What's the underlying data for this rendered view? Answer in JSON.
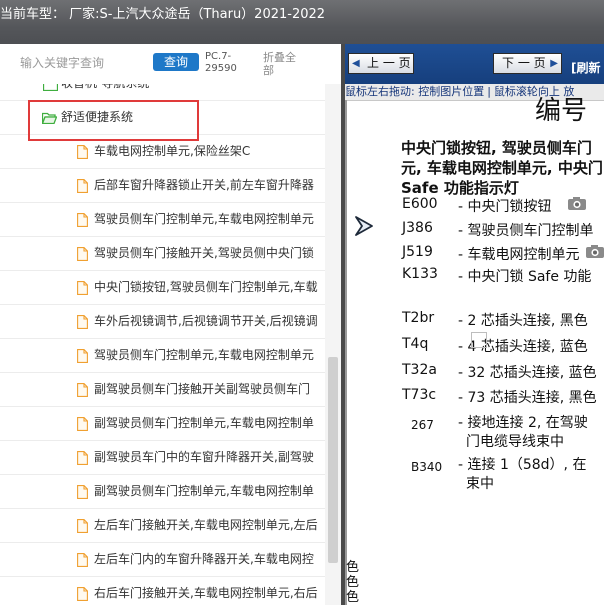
{
  "window": {
    "title": "当前车型： 厂家:S-上汽大众途岳（Tharu）2021-2022"
  },
  "search": {
    "placeholder": "输入关键字查询",
    "query_label": "查询",
    "pc_info": "PC.7-29590",
    "collapse_all_label": "折叠全部"
  },
  "tree": {
    "partial_folder_label": "收音机-导航系统",
    "open_folder_label": "舒适便捷系统",
    "documents": [
      "车载电网控制单元,保险丝架C",
      "后部车窗升降器锁止开关,前左车窗升降器",
      "驾驶员侧车门控制单元,车载电网控制单元",
      "驾驶员侧车门接触开关,驾驶员侧中央门锁",
      "中央门锁按钮,驾驶员侧车门控制单元,车载",
      "车外后视镜调节,后视镜调节开关,后视镜调",
      "驾驶员侧车门控制单元,车载电网控制单元",
      "副驾驶员侧车门接触开关副驾驶员侧车门",
      "副驾驶员侧车门控制单元,车载电网控制单",
      "副驾驶员车门中的车窗升降器开关,副驾驶",
      "副驾驶员侧车门控制单元,车载电网控制单",
      "左后车门接触开关,车载电网控制单元,左后",
      "左后车门内的车窗升降器开关,车载电网控",
      "右后车门接触开关,车载电网控制单元,右后"
    ]
  },
  "viewer": {
    "prev_label": "上 一 页",
    "next_label": "下 一 页",
    "refresh_label": "[刷新",
    "hint_drag": "鼠标左右拖动: 控制图片位置",
    "hint_scroll": "鼠标滚轮向上 放",
    "page_heading": "编号",
    "diagram_title_1": "中央门锁按钮, 驾驶员侧车门",
    "diagram_title_2": "元, 车载电网控制单元, 中央门",
    "diagram_title_3": "Safe 功能指示灯",
    "components": [
      {
        "code": "E600",
        "desc": "- 中央门锁按钮"
      },
      {
        "code": "J386",
        "desc": "- 驾驶员侧车门控制单"
      },
      {
        "code": "J519",
        "desc": "- 车载电网控制单元"
      },
      {
        "code": "K133",
        "desc": "- 中央门锁 Safe 功能"
      },
      {
        "code": "T2br",
        "desc": "- 2 芯插头连接, 黑色"
      },
      {
        "code": "T4q",
        "desc": "- 4 芯插头连接, 蓝色"
      },
      {
        "code": "T32a",
        "desc": "- 32 芯插头连接, 蓝色"
      },
      {
        "code": "T73c",
        "desc": "- 73 芯插头连接, 黑色"
      },
      {
        "code": "267",
        "desc_1": "- 接地连接 2, 在驾驶",
        "desc_2": "门电缆导线束中"
      },
      {
        "code": "B340",
        "desc_1": "- 连接 1（58d）, 在",
        "desc_2": "束中"
      }
    ],
    "bottom_color_label": "色 色 色"
  },
  "colors": {
    "accent_blue": "#1e78c8",
    "viewer_toolbar": "#1f4f95",
    "highlight_red": "#e03a3a",
    "folder_green": "#3fae3f",
    "doc_orange": "#f0a030"
  }
}
